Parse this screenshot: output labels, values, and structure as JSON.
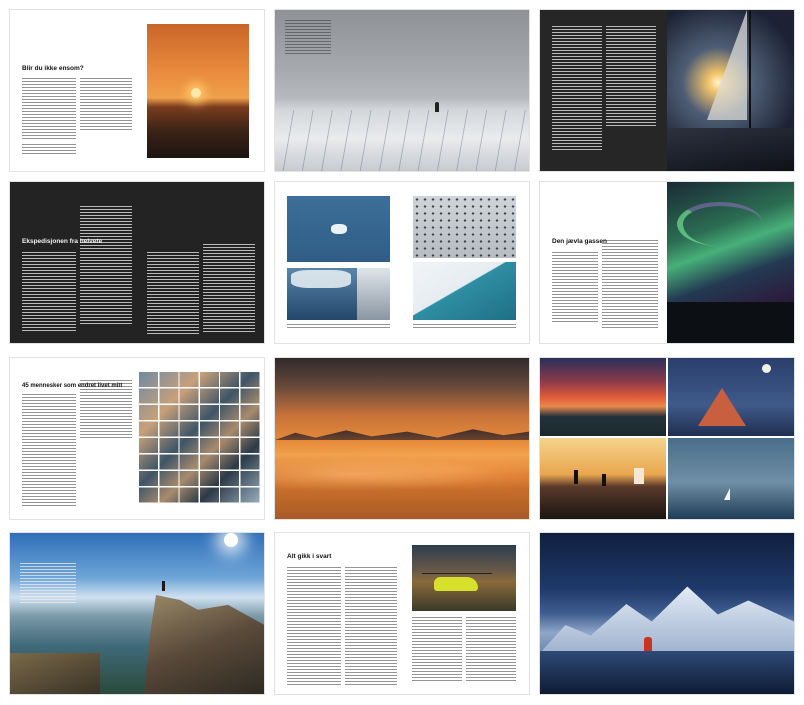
{
  "spreads": [
    {
      "id": "1",
      "heading": "Blir du ikke ensom?"
    },
    {
      "id": "2",
      "heading": ""
    },
    {
      "id": "3",
      "heading": ""
    },
    {
      "id": "4",
      "heading": "Ekspedisjonen fra helvete"
    },
    {
      "id": "5",
      "heading": ""
    },
    {
      "id": "6",
      "heading": "Den jævla gassen"
    },
    {
      "id": "7",
      "heading": "45 mennesker som endret livet mitt"
    },
    {
      "id": "8",
      "heading": ""
    },
    {
      "id": "9",
      "heading": ""
    },
    {
      "id": "10",
      "heading": ""
    },
    {
      "id": "11",
      "heading": "Alt gikk i svart"
    },
    {
      "id": "12",
      "heading": ""
    }
  ],
  "colors": {
    "page_bg": "#ffffff",
    "dark_page": "#232323",
    "sunset_orange": "#e88a3a",
    "ice_grey": "#9ea3a8",
    "night_blue": "#1d2a44",
    "aurora_green": "#3fae6a"
  }
}
